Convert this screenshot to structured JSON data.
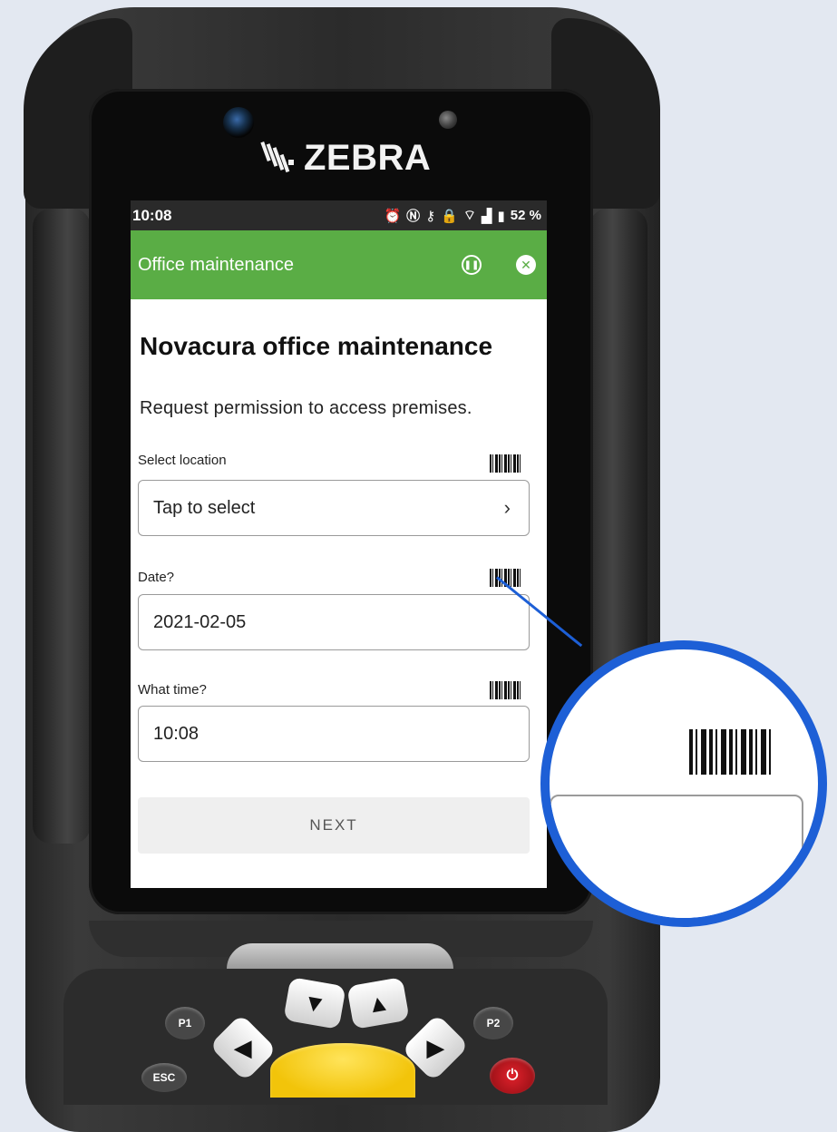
{
  "device": {
    "brand": "ZEBRA",
    "keys": {
      "p1": "P1",
      "p2": "P2",
      "esc": "ESC"
    }
  },
  "statusbar": {
    "time": "10:08",
    "battery": "52 %"
  },
  "appbar": {
    "title": "Office maintenance"
  },
  "page": {
    "heading": "Novacura office maintenance",
    "intro": "Request permission to access premises."
  },
  "fields": {
    "location": {
      "label": "Select location",
      "value": "Tap to select"
    },
    "date": {
      "label": "Date?",
      "value": "2021-02-05"
    },
    "time": {
      "label": "What time?",
      "value": "10:08"
    }
  },
  "buttons": {
    "next": "NEXT"
  },
  "colors": {
    "appbar": "#5aad45",
    "callout": "#1d5fd6",
    "background": "#e3e8f1"
  }
}
